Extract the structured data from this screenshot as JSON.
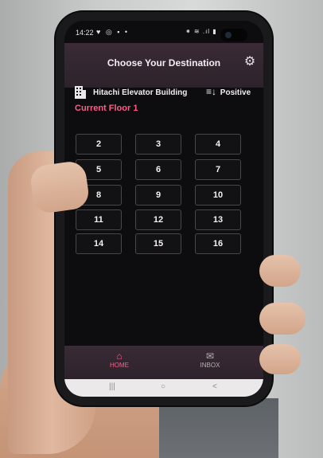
{
  "status_bar": {
    "time": "14:22",
    "left_icons": "♥ ◎ ▪ •",
    "right_icons": "⁕ ≋ .ıl ▮"
  },
  "app_bar": {
    "title": "Choose Your Destination",
    "settings_icon": "gear-icon"
  },
  "building": {
    "name": "Hitachi Elevator Building",
    "direction_label": "Positive",
    "direction_icon": "sort-ascending-icon"
  },
  "current_floor_label": "Current Floor 1",
  "floors": [
    "2",
    "3",
    "4",
    "5",
    "6",
    "7",
    "8",
    "9",
    "10",
    "11",
    "12",
    "13",
    "14",
    "15",
    "16"
  ],
  "bottom_nav": {
    "home_label": "HOME",
    "inbox_label": "INBOX"
  },
  "system_nav": {
    "recents": "|||",
    "home": "○",
    "back": "<"
  },
  "colors": {
    "accent": "#ff5c8a",
    "appbar": "#33262f",
    "screen_bg": "#0d0c0e"
  }
}
